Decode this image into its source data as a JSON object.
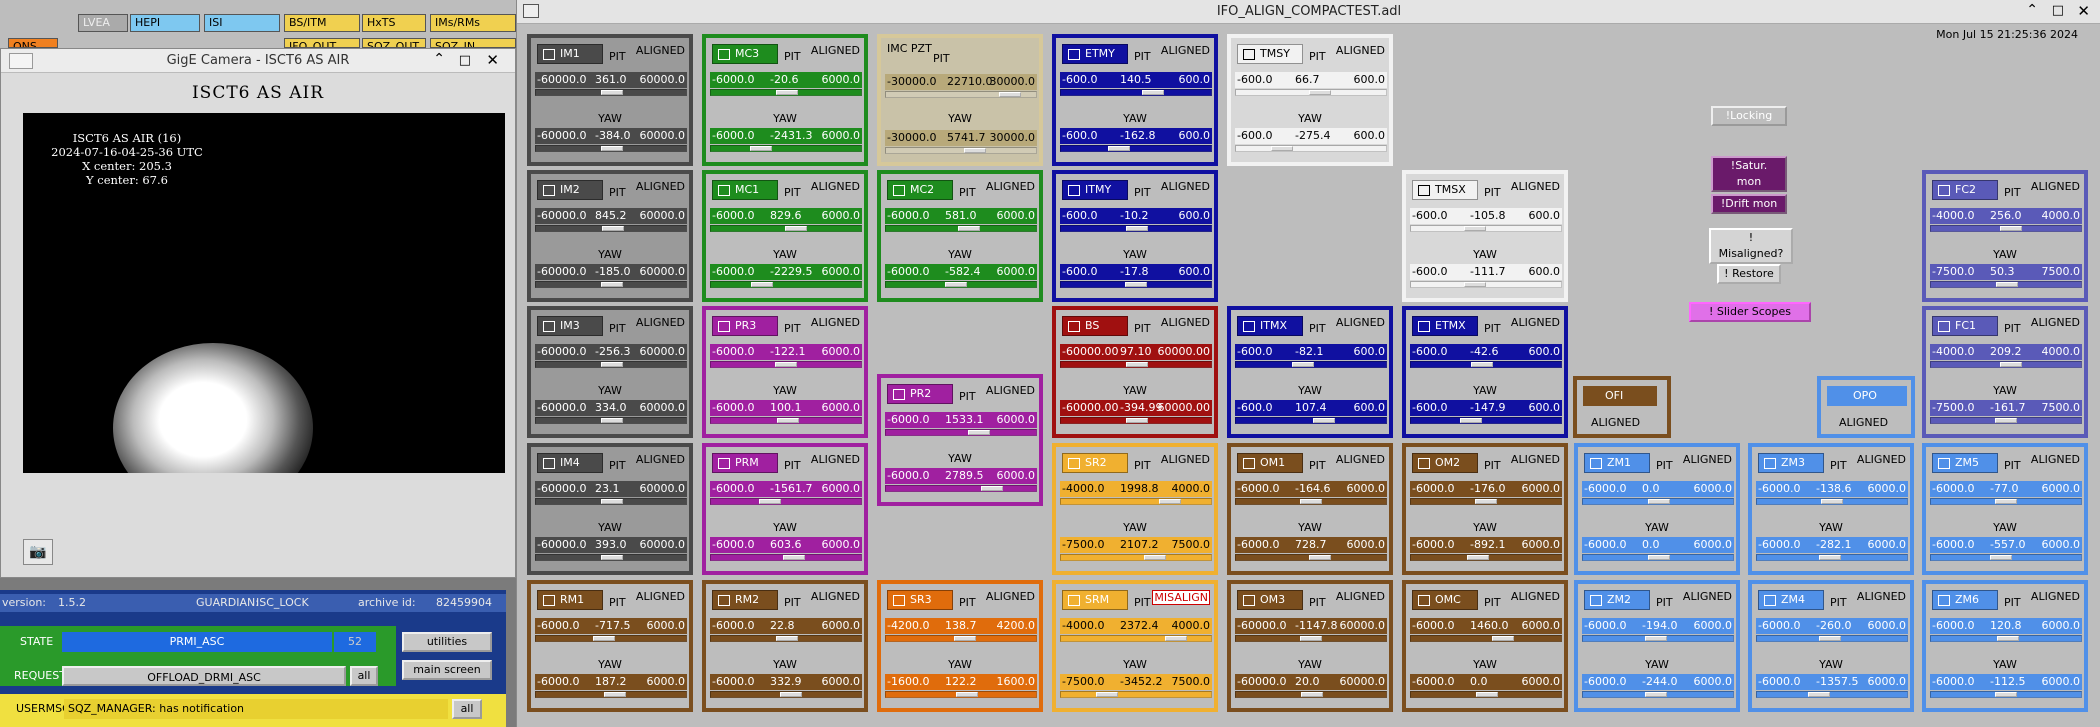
{
  "toolbar": {
    "items": [
      "LVEA",
      "HEPI",
      "ISI",
      "BS/ITM",
      "HxTS",
      "IMs/RMs",
      "ONS",
      "IFO_OUT",
      "SQZ_OUT",
      "SQZ_IN"
    ]
  },
  "camera": {
    "window_title": "GigE Camera - ISCT6 AS AIR",
    "heading": "ISCT6 AS AIR",
    "overlay": [
      "ISCT6 AS AIR (16)",
      "2024-07-16-04-25-36 UTC",
      "X center: 205.3",
      "Y center: 67.6"
    ],
    "snapshot_icon": "camera-icon"
  },
  "guardian": {
    "version_label": "version:",
    "version": "1.5.2",
    "guardian_label": "GUARDIAN:",
    "node": "ISC_LOCK",
    "archive_label": "archive id:",
    "archive_id": "82459904",
    "state_label": "STATE",
    "state": "PRMI_ASC",
    "state_num": "52",
    "request_label": "REQUEST",
    "request": "OFFLOAD_DRMI_ASC",
    "all_label": "all",
    "utilities": "utilities",
    "main_screen": "main screen",
    "usermsg_label": "USERMSG",
    "usermsg": "SQZ_MANAGER: has notification",
    "usermsg_all": "all"
  },
  "medm": {
    "title": "IFO_ALIGN_COMPACTEST.adl",
    "datetime": "Mon Jul 15 21:25:36 2024"
  },
  "labels": {
    "pit": "PIT",
    "yaw": "YAW",
    "imcpzt": "IMC PZT"
  },
  "side_buttons": [
    "!Locking",
    "!Satur. mon",
    "!Drift mon",
    "! Misaligned?",
    "! Restore",
    "! Slider Scopes"
  ],
  "colors": {
    "gray": "#4a4a4a",
    "green": "#1e8c1e",
    "yellow": "#b8a97a",
    "blue": "#1010a0",
    "white": "#f2f2f2",
    "purple": "#a020a0",
    "red": "#a01010",
    "brown": "#7a4e1e",
    "orange": "#e06c0c",
    "gold": "#f0b030",
    "lightblue": "#5090e8",
    "violet": "#5a5ab8"
  },
  "widgets": [
    {
      "name": "IM1",
      "status": "ALIGNED",
      "pit": [
        "-60000.0",
        "361.0",
        "60000.0"
      ],
      "yaw": [
        "-60000.0",
        "-384.0",
        "60000.0"
      ],
      "pk": 0.5,
      "yk": 0.5
    },
    {
      "name": "IM2",
      "status": "ALIGNED",
      "pit": [
        "-60000.0",
        "845.2",
        "60000.0"
      ],
      "yaw": [
        "-60000.0",
        "-185.0",
        "60000.0"
      ],
      "pk": 0.51,
      "yk": 0.5
    },
    {
      "name": "IM3",
      "status": "ALIGNED",
      "pit": [
        "-60000.0",
        "-256.3",
        "60000.0"
      ],
      "yaw": [
        "-60000.0",
        "334.0",
        "60000.0"
      ],
      "pk": 0.5,
      "yk": 0.5
    },
    {
      "name": "IM4",
      "status": "ALIGNED",
      "pit": [
        "-60000.0",
        "23.1",
        "60000.0"
      ],
      "yaw": [
        "-60000.0",
        "393.0",
        "60000.0"
      ],
      "pk": 0.5,
      "yk": 0.5
    },
    {
      "name": "RM1",
      "status": "ALIGNED",
      "pit": [
        "-6000.0",
        "-717.5",
        "6000.0"
      ],
      "yaw": [
        "-6000.0",
        "187.2",
        "6000.0"
      ],
      "pk": 0.44,
      "yk": 0.52
    },
    {
      "name": "MC3",
      "status": "ALIGNED",
      "pit": [
        "-6000.0",
        "-20.6",
        "6000.0"
      ],
      "yaw": [
        "-6000.0",
        "-2431.3",
        "6000.0"
      ],
      "pk": 0.5,
      "yk": 0.3
    },
    {
      "name": "MC1",
      "status": "ALIGNED",
      "pit": [
        "-6000.0",
        "829.6",
        "6000.0"
      ],
      "yaw": [
        "-6000.0",
        "-2229.5",
        "6000.0"
      ],
      "pk": 0.57,
      "yk": 0.31
    },
    {
      "name": "PR3",
      "status": "ALIGNED",
      "pit": [
        "-6000.0",
        "-122.1",
        "6000.0"
      ],
      "yaw": [
        "-6000.0",
        "100.1",
        "6000.0"
      ],
      "pk": 0.49,
      "yk": 0.51
    },
    {
      "name": "PRM",
      "status": "ALIGNED",
      "pit": [
        "-6000.0",
        "-1561.7",
        "6000.0"
      ],
      "yaw": [
        "-6000.0",
        "603.6",
        "6000.0"
      ],
      "pk": 0.37,
      "yk": 0.55
    },
    {
      "name": "RM2",
      "status": "ALIGNED",
      "pit": [
        "-6000.0",
        "22.8",
        "6000.0"
      ],
      "yaw": [
        "-6000.0",
        "332.9",
        "6000.0"
      ],
      "pk": 0.5,
      "yk": 0.53
    },
    {
      "name": "MC2",
      "status": "ALIGNED",
      "pit": [
        "-6000.0",
        "581.0",
        "6000.0"
      ],
      "yaw": [
        "-6000.0",
        "-582.4",
        "6000.0"
      ],
      "pk": 0.55,
      "yk": 0.45
    },
    {
      "name": "PR2",
      "status": "ALIGNED",
      "pit": [
        "-6000.0",
        "1533.1",
        "6000.0"
      ],
      "yaw": [
        "-6000.0",
        "2789.5",
        "6000.0"
      ],
      "pk": 0.63,
      "yk": 0.73
    },
    {
      "name": "SR3",
      "status": "ALIGNED",
      "pit": [
        "-4200.0",
        "138.7",
        "4200.0"
      ],
      "yaw": [
        "-1600.0",
        "122.2",
        "1600.0"
      ],
      "pk": 0.52,
      "yk": 0.54
    },
    {
      "name": "ETMY",
      "status": "ALIGNED",
      "pit": [
        "-600.0",
        "140.5",
        "600.0"
      ],
      "yaw": [
        "-600.0",
        "-162.8",
        "600.0"
      ],
      "pk": 0.62,
      "yk": 0.36
    },
    {
      "name": "ITMY",
      "status": "ALIGNED",
      "pit": [
        "-600.0",
        "-10.2",
        "600.0"
      ],
      "yaw": [
        "-600.0",
        "-17.8",
        "600.0"
      ],
      "pk": 0.5,
      "yk": 0.49
    },
    {
      "name": "BS",
      "status": "ALIGNED",
      "pit": [
        "-60000.00",
        "97.10",
        "60000.00"
      ],
      "yaw": [
        "-60000.00",
        "-394.99",
        "60000.00"
      ],
      "pk": 0.5,
      "yk": 0.5
    },
    {
      "name": "SR2",
      "status": "ALIGNED",
      "pit": [
        "-4000.0",
        "1998.8",
        "4000.0"
      ],
      "yaw": [
        "-7500.0",
        "2107.2",
        "7500.0"
      ],
      "pk": 0.75,
      "yk": 0.64
    },
    {
      "name": "SRM",
      "status": "MISALIGN",
      "pit": [
        "-4000.0",
        "2372.4",
        "4000.0"
      ],
      "yaw": [
        "-7500.0",
        "-3452.2",
        "7500.0"
      ],
      "pk": 0.8,
      "yk": 0.27
    },
    {
      "name": "TMSY",
      "status": "ALIGNED",
      "pit": [
        "-600.0",
        "66.7",
        "600.0"
      ],
      "yaw": [
        "-600.0",
        "-275.4",
        "600.0"
      ],
      "pk": 0.56,
      "yk": 0.27
    },
    {
      "name": "ITMX",
      "status": "ALIGNED",
      "pit": [
        "-600.0",
        "-82.1",
        "600.0"
      ],
      "yaw": [
        "-600.0",
        "107.4",
        "600.0"
      ],
      "pk": 0.43,
      "yk": 0.59
    },
    {
      "name": "OM1",
      "status": "ALIGNED",
      "pit": [
        "-6000.0",
        "-164.6",
        "6000.0"
      ],
      "yaw": [
        "-6000.0",
        "728.7",
        "6000.0"
      ],
      "pk": 0.49,
      "yk": 0.56
    },
    {
      "name": "OM3",
      "status": "ALIGNED",
      "pit": [
        "-60000.0",
        "-1147.8",
        "60000.0"
      ],
      "yaw": [
        "-60000.0",
        "20.0",
        "60000.0"
      ],
      "pk": 0.49,
      "yk": 0.5
    },
    {
      "name": "TMSX",
      "status": "ALIGNED",
      "pit": [
        "-600.0",
        "-105.8",
        "600.0"
      ],
      "yaw": [
        "-600.0",
        "-111.7",
        "600.0"
      ],
      "pk": 0.41,
      "yk": 0.41
    },
    {
      "name": "ETMX",
      "status": "ALIGNED",
      "pit": [
        "-600.0",
        "-42.6",
        "600.0"
      ],
      "yaw": [
        "-600.0",
        "-147.9",
        "600.0"
      ],
      "pk": 0.46,
      "yk": 0.38
    },
    {
      "name": "OM2",
      "status": "ALIGNED",
      "pit": [
        "-6000.0",
        "-176.0",
        "6000.0"
      ],
      "yaw": [
        "-6000.0",
        "-892.1",
        "6000.0"
      ],
      "pk": 0.49,
      "yk": 0.43
    },
    {
      "name": "OMC",
      "status": "ALIGNED",
      "pit": [
        "-6000.0",
        "1460.0",
        "6000.0"
      ],
      "yaw": [
        "-6000.0",
        "0.0",
        "6000.0"
      ],
      "pk": 0.62,
      "yk": 0.5
    },
    {
      "name": "ZM1",
      "status": "ALIGNED",
      "pit": [
        "-6000.0",
        "0.0",
        "6000.0"
      ],
      "yaw": [
        "-6000.0",
        "0.0",
        "6000.0"
      ],
      "pk": 0.5,
      "yk": 0.5
    },
    {
      "name": "ZM2",
      "status": "ALIGNED",
      "pit": [
        "-6000.0",
        "-194.0",
        "6000.0"
      ],
      "yaw": [
        "-6000.0",
        "-244.0",
        "6000.0"
      ],
      "pk": 0.48,
      "yk": 0.48
    },
    {
      "name": "ZM3",
      "status": "ALIGNED",
      "pit": [
        "-6000.0",
        "-138.6",
        "6000.0"
      ],
      "yaw": [
        "-6000.0",
        "-282.1",
        "6000.0"
      ],
      "pk": 0.49,
      "yk": 0.48
    },
    {
      "name": "ZM4",
      "status": "ALIGNED",
      "pit": [
        "-6000.0",
        "-260.0",
        "6000.0"
      ],
      "yaw": [
        "-6000.0",
        "-1357.5",
        "6000.0"
      ],
      "pk": 0.48,
      "yk": 0.39
    },
    {
      "name": "FC2",
      "status": "ALIGNED",
      "pit": [
        "-4000.0",
        "256.0",
        "4000.0"
      ],
      "yaw": [
        "-7500.0",
        "50.3",
        "7500.0"
      ],
      "pk": 0.53,
      "yk": 0.5
    },
    {
      "name": "FC1",
      "status": "ALIGNED",
      "pit": [
        "-4000.0",
        "209.2",
        "4000.0"
      ],
      "yaw": [
        "-7500.0",
        "-161.7",
        "7500.0"
      ],
      "pk": 0.53,
      "yk": 0.49
    },
    {
      "name": "ZM5",
      "status": "ALIGNED",
      "pit": [
        "-6000.0",
        "-77.0",
        "6000.0"
      ],
      "yaw": [
        "-6000.0",
        "-557.0",
        "6000.0"
      ],
      "pk": 0.49,
      "yk": 0.45
    },
    {
      "name": "ZM6",
      "status": "ALIGNED",
      "pit": [
        "-6000.0",
        "120.8",
        "6000.0"
      ],
      "yaw": [
        "-6000.0",
        "-112.5",
        "6000.0"
      ],
      "pk": 0.51,
      "yk": 0.49
    }
  ],
  "imcpzt": {
    "pit": [
      "-30000.0",
      "22710.0",
      "30000.0"
    ],
    "yaw": [
      "-30000.0",
      "5741.7",
      "30000.0"
    ],
    "pk": 0.87,
    "yk": 0.6
  },
  "small": [
    {
      "name": "OFI",
      "status": "ALIGNED"
    },
    {
      "name": "OPO",
      "status": "ALIGNED"
    }
  ]
}
